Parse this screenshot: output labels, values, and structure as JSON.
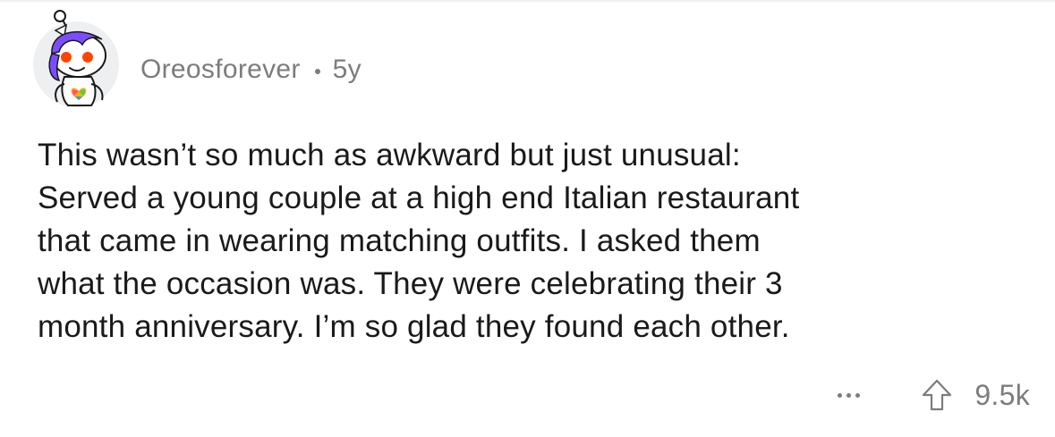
{
  "comment": {
    "username": "Oreosforever",
    "age": "5y",
    "text": "This wasn’t so much as awkward but just unusual:\nServed a young couple at a high end Italian restaurant\nthat came in wearing matching outfits. I asked them\nwhat the occasion was. They were celebrating their 3\nmonth anniversary. I’m so glad they found each other.",
    "vote_count": "9.5k"
  },
  "icons": {
    "avatar": "snoo-avatar-icon",
    "more": "more-options-icon",
    "upvote": "upvote-arrow-icon"
  },
  "colors": {
    "meta_gray": "#7c7c7c",
    "text": "#1a1a1b",
    "avatar_hair": "#7c4dff",
    "avatar_eyes": "#ff4500"
  }
}
